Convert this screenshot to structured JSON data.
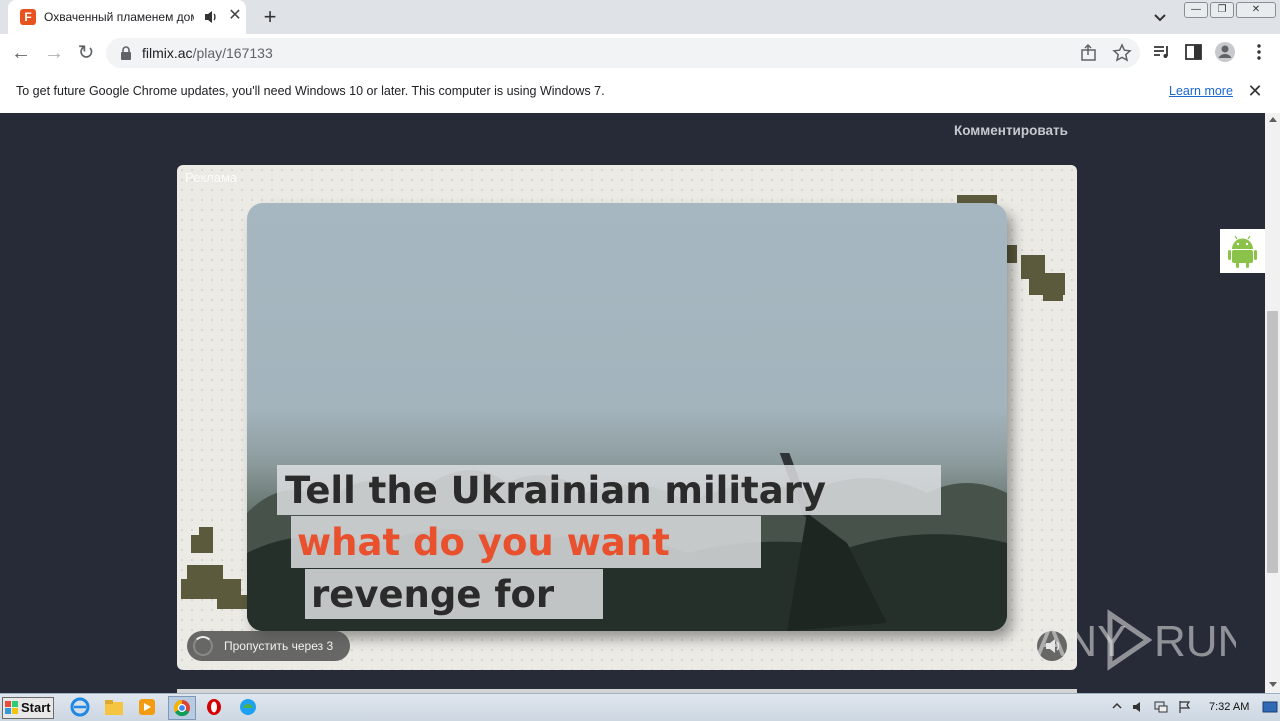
{
  "browser": {
    "tab_title": "Охваченный пламенем дом Мэри",
    "url_host": "filmix.ac",
    "url_path": "/play/167133"
  },
  "infobar": {
    "message": "To get future Google Chrome updates, you'll need Windows 10 or later. This computer is using Windows 7.",
    "learn_more": "Learn more"
  },
  "page": {
    "comment_link": "Комментировать",
    "ad_label": "Реклама",
    "ad_caption_line1": "Tell the Ukrainian military",
    "ad_caption_line2": "what do you want",
    "ad_caption_line3": "revenge for",
    "skip_text": "Пропустить через 3"
  },
  "watermark": {
    "text_left": "ANY",
    "text_right": "RUN"
  },
  "taskbar": {
    "start_label": "Start",
    "clock": "7:32 AM"
  },
  "colors": {
    "page_bg": "#272b37",
    "caption_red": "#e8502e",
    "caption_dark": "#2b2b2b"
  }
}
